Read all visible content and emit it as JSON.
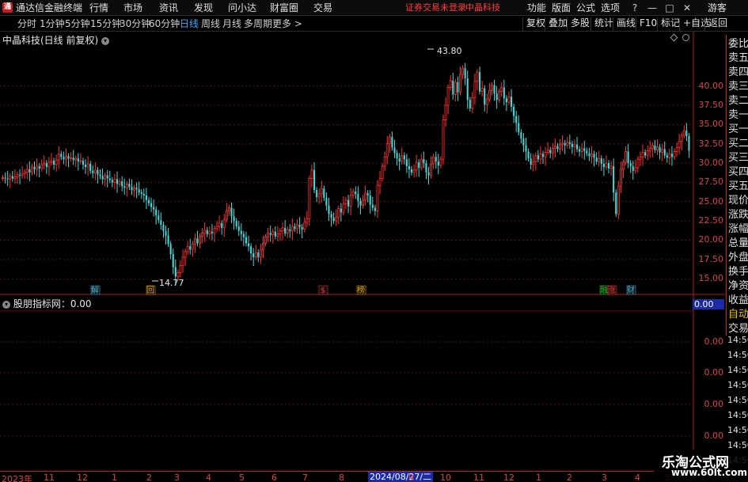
{
  "menubar": {
    "app_title": "通达信金融终端",
    "items": [
      "行情",
      "市场",
      "资讯",
      "发现",
      "问小达",
      "财富圈",
      "交易"
    ],
    "alert": "证券交易未登录",
    "stock_name": "中晶科技",
    "right_items": [
      "功能",
      "版面",
      "公式",
      "选项"
    ],
    "guest": "游客"
  },
  "periodbar": {
    "periods": [
      "分时",
      "1分钟",
      "5分钟",
      "15分钟",
      "30分钟",
      "60分钟",
      "日线",
      "周线",
      "月线",
      "多周期",
      "更多 >"
    ],
    "active": "日线",
    "tools": [
      "复权",
      "叠加",
      "多股",
      "统计",
      "画线",
      "F10",
      "标记",
      "+自选",
      "返回"
    ]
  },
  "main_chart": {
    "title": "中晶科技(日线 前复权)",
    "high_label": "43.80",
    "low_label": "14.77",
    "y_ticks": [
      "40.00",
      "37.50",
      "35.00",
      "32.50",
      "30.00",
      "27.50",
      "25.00",
      "22.50",
      "20.00",
      "17.50",
      "15.00"
    ],
    "event_markers": [
      {
        "label": "解",
        "color": "#4db8d8"
      },
      {
        "label": "回",
        "color": "#e0a000"
      },
      {
        "label": "$",
        "color": "#ff3030"
      },
      {
        "label": "榜",
        "color": "#e0a000"
      },
      {
        "label": "融",
        "color": "#22c022"
      },
      {
        "label": "涨",
        "color": "#ff3030"
      },
      {
        "label": "财",
        "color": "#4db8d8"
      }
    ]
  },
  "sub_chart": {
    "title": "股朋指标网：0.00",
    "value_box": "0.00",
    "y_ticks": [
      "0.00",
      "0.00",
      "0.00",
      "0.00"
    ]
  },
  "right_panel": {
    "labels": [
      "委比",
      "卖五",
      "卖四",
      "卖三",
      "卖二",
      "卖一",
      "买一",
      "买二",
      "买三",
      "买四",
      "买五",
      "现价",
      "涨跌",
      "涨幅",
      "总量",
      "外盘",
      "换手",
      "净资",
      "收益",
      "自动",
      "交易"
    ],
    "time_ticks": [
      "14:56",
      "14:56",
      "14:56",
      "14:56",
      "14:56",
      "14:56",
      "14:56",
      "14:56",
      "14:56"
    ]
  },
  "date_axis": {
    "labels": [
      "2023年",
      "11",
      "12",
      "1",
      "2",
      "3",
      "4",
      "5",
      "6",
      "7",
      "8",
      "9",
      "10",
      "11",
      "12",
      "1",
      "2",
      "3",
      "4",
      "5"
    ],
    "highlight": "2024/08/27/二"
  },
  "watermark": {
    "line1": "乐淘公式网",
    "line2": "www.60lt.com"
  },
  "chart_data": {
    "type": "candlestick",
    "high": 43.8,
    "low": 14.77,
    "ylim": [
      14.2,
      45.2
    ],
    "closes": [
      28.1,
      28.0,
      27.9,
      28.3,
      28.0,
      28.2,
      28.5,
      28.4,
      28.6,
      28.8,
      29.2,
      28.8,
      29.5,
      29.2,
      29.6,
      29.3,
      29.8,
      30.0,
      29.5,
      30.1,
      30.3,
      29.8,
      30.4,
      31.2,
      30.8,
      30.5,
      30.9,
      30.6,
      30.7,
      30.4,
      30.6,
      30.2,
      30.3,
      29.8,
      29.5,
      29.9,
      29.0,
      28.7,
      29.1,
      28.5,
      28.3,
      27.9,
      28.4,
      28.0,
      27.8,
      27.5,
      27.9,
      27.3,
      27.6,
      27.0,
      26.8,
      27.3,
      26.9,
      26.5,
      26.8,
      26.6,
      26.2,
      26.0,
      25.8,
      25.2,
      24.8,
      24.3,
      24.0,
      23.2,
      22.6,
      22.0,
      21.2,
      20.6,
      19.5,
      18.2,
      16.5,
      15.3,
      15.8,
      16.7,
      17.8,
      18.5,
      19.2,
      18.8,
      19.5,
      20.2,
      19.6,
      20.5,
      20.9,
      21.3,
      20.8,
      21.1,
      20.9,
      21.5,
      21.8,
      22.2,
      21.6,
      22.7,
      23.8,
      24.2,
      23.1,
      22.5,
      21.8,
      21.2,
      20.8,
      20.4,
      19.6,
      19.2,
      18.3,
      17.8,
      18.4,
      17.8,
      18.8,
      19.6,
      20.4,
      20.9,
      20.7,
      21.1,
      20.5,
      20.8,
      21.2,
      21.6,
      20.9,
      21.4,
      21.2,
      21.8,
      21.5,
      22.0,
      21.7,
      21.4,
      22.3,
      22.8,
      28.0,
      29.1,
      26.5,
      25.6,
      26.0,
      26.7,
      25.5,
      24.5,
      23.4,
      22.9,
      22.5,
      23.0,
      24.1,
      23.6,
      24.7,
      25.2,
      24.4,
      25.8,
      26.3,
      26.0,
      25.1,
      24.5,
      25.2,
      26.1,
      25.8,
      24.6,
      24.2,
      23.8,
      27.1,
      28.0,
      29.6,
      30.8,
      32.5,
      33.4,
      32.0,
      31.3,
      30.6,
      30.2,
      31.0,
      30.5,
      29.6,
      29.2,
      28.8,
      29.1,
      30.1,
      29.4,
      30.5,
      30.0,
      28.8,
      28.4,
      29.9,
      30.8,
      30.2,
      29.7,
      30.5,
      35.6,
      37.5,
      39.8,
      40.7,
      38.9,
      40.5,
      39.2,
      41.5,
      42.3,
      41.0,
      38.2,
      37.1,
      38.5,
      40.6,
      41.8,
      39.3,
      39.7,
      37.6,
      38.3,
      39.4,
      40.1,
      39.0,
      38.2,
      39.3,
      39.8,
      38.4,
      37.9,
      38.6,
      37.3,
      36.1,
      35.2,
      34.0,
      33.2,
      32.3,
      31.5,
      30.6,
      29.8,
      30.2,
      31.0,
      30.5,
      31.2,
      30.8,
      31.4,
      31.7,
      31.3,
      31.9,
      32.2,
      31.8,
      32.4,
      32.6,
      32.3,
      32.7,
      32.5,
      32.1,
      32.4,
      31.8,
      31.5,
      31.9,
      31.6,
      31.3,
      30.9,
      31.2,
      30.7,
      30.2,
      30.6,
      29.9,
      29.5,
      30.0,
      29.3,
      29.6,
      26.2,
      23.4,
      27.0,
      29.2,
      30.1,
      31.5,
      30.0,
      29.6,
      29.0,
      29.4,
      30.5,
      30.8,
      31.4,
      31.0,
      31.6,
      31.9,
      32.3,
      31.7,
      32.1,
      31.4,
      31.8,
      31.0,
      30.7,
      31.2,
      30.8,
      31.5,
      32.0,
      32.8,
      33.6,
      34.2,
      33.5,
      31.6
    ]
  }
}
